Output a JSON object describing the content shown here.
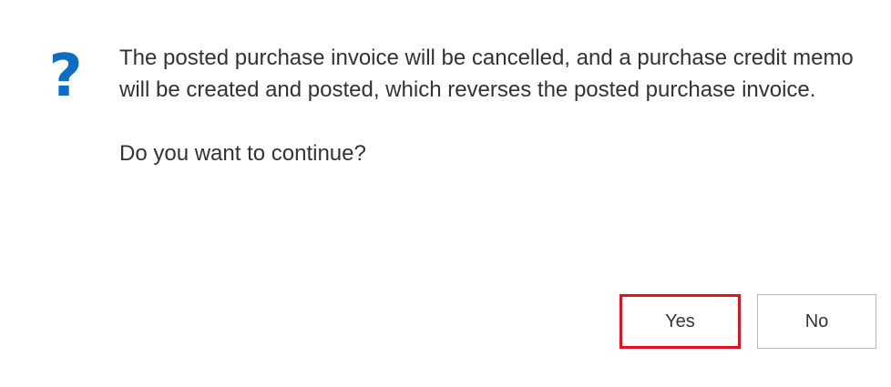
{
  "dialog": {
    "icon": "question-mark-icon",
    "icon_glyph": "?",
    "icon_color": "#0b6ec4",
    "message_line": "The posted purchase invoice will be cancelled, and a purchase credit memo will be created and posted, which reverses the posted purchase invoice.",
    "question": "Do you want to continue?",
    "buttons": {
      "yes_label": "Yes",
      "no_label": "No"
    },
    "highlight_color": "#e0121f"
  }
}
